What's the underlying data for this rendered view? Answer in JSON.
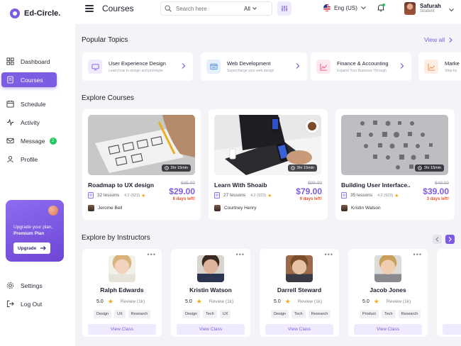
{
  "app": {
    "name": "Ed-Circle."
  },
  "header": {
    "title": "Courses",
    "search_placeholder": "Search here",
    "search_scope": "All",
    "language": "Eng (US)",
    "user_name": "Safurah",
    "user_role": "Student"
  },
  "sidebar": {
    "items": [
      {
        "label": "Dashboard",
        "icon": "dashboard-icon"
      },
      {
        "label": "Courses",
        "icon": "courses-icon",
        "active": true
      },
      {
        "label": "Schedule",
        "icon": "calendar-icon"
      },
      {
        "label": "Activity",
        "icon": "activity-icon"
      },
      {
        "label": "Message",
        "icon": "mail-icon",
        "badge": "2"
      },
      {
        "label": "Profile",
        "icon": "user-icon"
      }
    ],
    "promo": {
      "line1": "Upgrade your plan,",
      "line2": "Premium Plan",
      "button": "Upgrade"
    },
    "bottom": [
      {
        "label": "Settings",
        "icon": "gear-icon"
      },
      {
        "label": "Log Out",
        "icon": "logout-icon"
      }
    ]
  },
  "popular": {
    "title": "Popular Topics",
    "view_all": "View all",
    "topics": [
      {
        "title": "User Experience Design",
        "subtitle": "Learn how to design and prototype"
      },
      {
        "title": "Web Development",
        "subtitle": "Supercharge your web design"
      },
      {
        "title": "Finance & Accounting",
        "subtitle": "Expand Your Business Through"
      },
      {
        "title": "Marke",
        "subtitle": "Step-by"
      }
    ]
  },
  "explore": {
    "title": "Explore Courses",
    "courses": [
      {
        "title": "Roadmap to UX design",
        "duration": "3hr 15min",
        "lessons": "32 lessons",
        "rating": "4.2 (923)",
        "old_price": "$35.00",
        "price": "$29.00",
        "days_left": "8 days left!",
        "instructor": "Jerome Bell"
      },
      {
        "title": "Learn With Shoaib",
        "duration": "3hr 15min",
        "lessons": "27 lessons",
        "rating": "4.2 (923)",
        "old_price": "$99.00",
        "price": "$79.00",
        "days_left": "9 days left!",
        "instructor": "Courtney Henry"
      },
      {
        "title": "Building User Interface..",
        "duration": "3hr 15min",
        "lessons": "35 lessons",
        "rating": "4.2 (923)",
        "old_price": "$49.00",
        "price": "$39.00",
        "days_left": "3 days left!",
        "instructor": "Kristin Watson"
      }
    ]
  },
  "instructors": {
    "title": "Explore by Instructors",
    "list": [
      {
        "name": "Ralph Edwards",
        "rating": "5.0",
        "review": "Review (1k)",
        "tags": [
          "Design",
          "UX",
          "Research"
        ],
        "button": "View Class"
      },
      {
        "name": "Kristin Watson",
        "rating": "5.0",
        "review": "Review (1k)",
        "tags": [
          "Design",
          "Tech",
          "UX"
        ],
        "button": "View Class"
      },
      {
        "name": "Darrell Steward",
        "rating": "5.0",
        "review": "Review (1k)",
        "tags": [
          "Design",
          "Tech",
          "Research"
        ],
        "button": "View Class"
      },
      {
        "name": "Jacob Jones",
        "rating": "5.0",
        "review": "Review (1k)",
        "tags": [
          "Product",
          "Tech",
          "Research"
        ],
        "button": "View Class"
      }
    ]
  },
  "colors": {
    "accent": "#7c5ce0",
    "accent_soft": "#efeafd",
    "deadline": "#e8542f",
    "star": "#f5a623",
    "success": "#22c55e"
  }
}
